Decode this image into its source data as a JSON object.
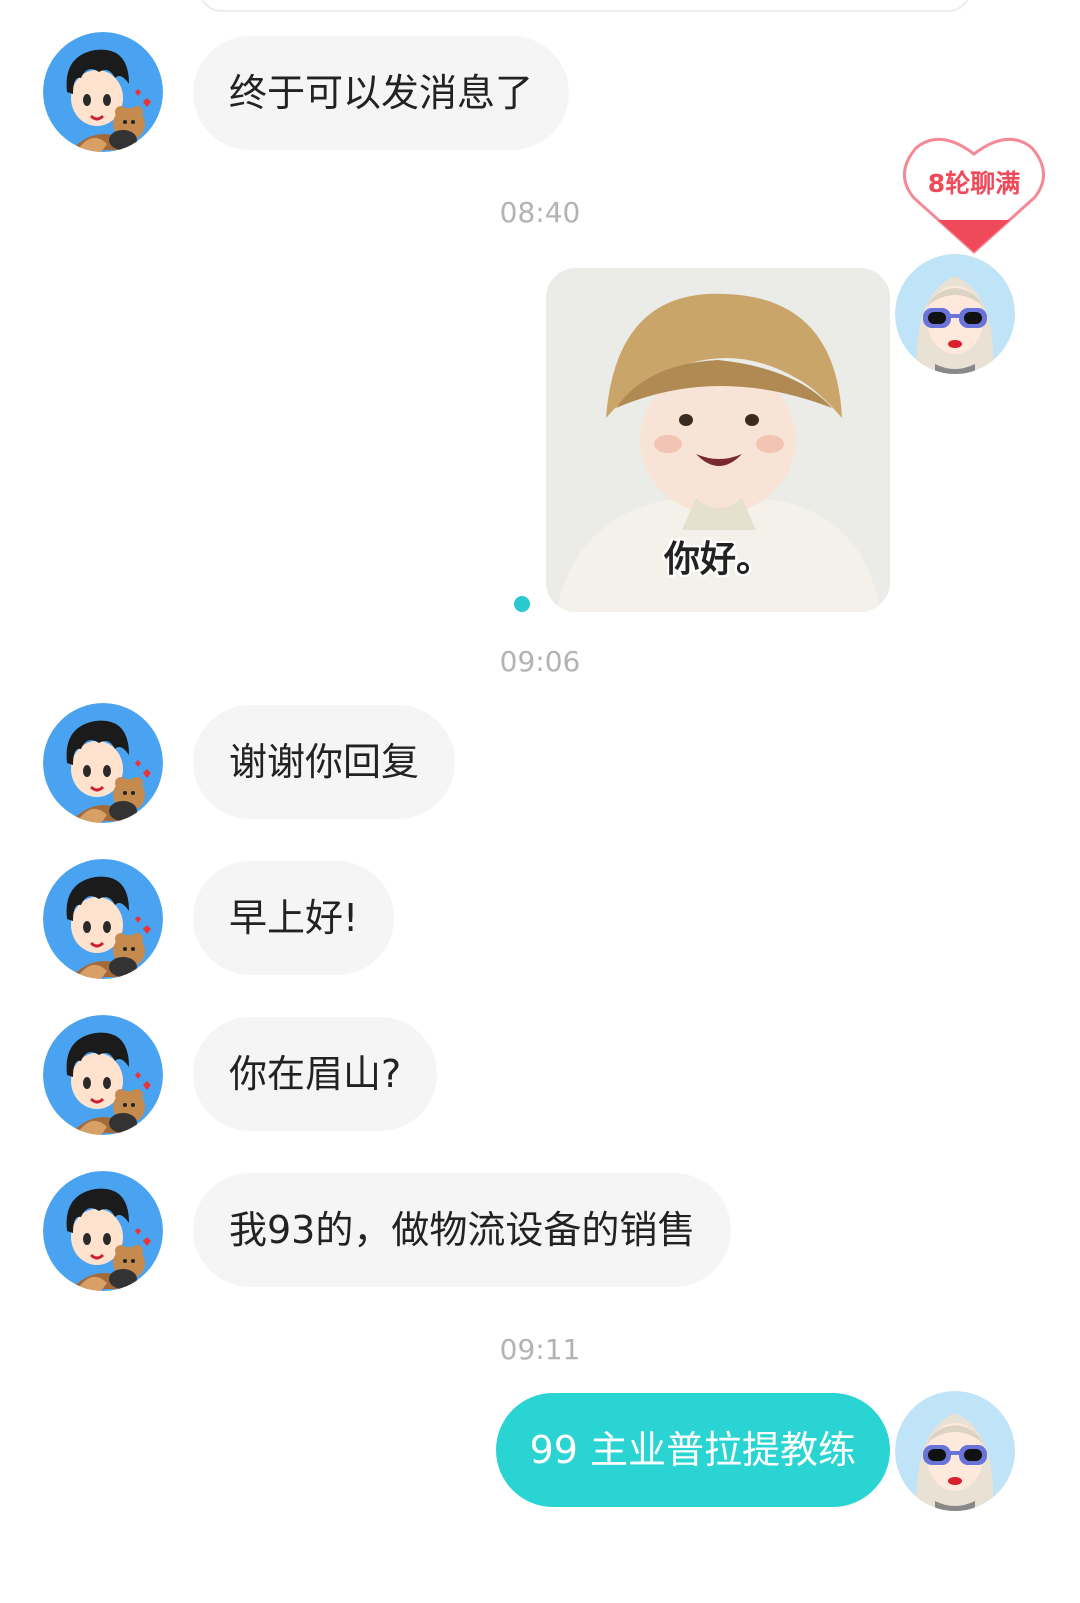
{
  "messages": [
    {
      "text": "终于可以发消息了"
    },
    {
      "text": "谢谢你回复"
    },
    {
      "text": "早上好!"
    },
    {
      "text": "你在眉山?"
    },
    {
      "text": "我93的，做物流设备的销售"
    }
  ],
  "outgoing": [
    {
      "text": "99 主业普拉提教练"
    }
  ],
  "timestamps": [
    "08:40",
    "09:06",
    "09:11"
  ],
  "badge": {
    "label": "8轮聊满"
  },
  "photo": {
    "caption": "你好。"
  },
  "colors": {
    "outgoing_bubble": "#2ad4d3",
    "incoming_bubble": "#f5f5f5",
    "avatar_bg": "#4aa3f0",
    "badge_red": "#f04a5a",
    "read_dot": "#2ac9d0"
  }
}
